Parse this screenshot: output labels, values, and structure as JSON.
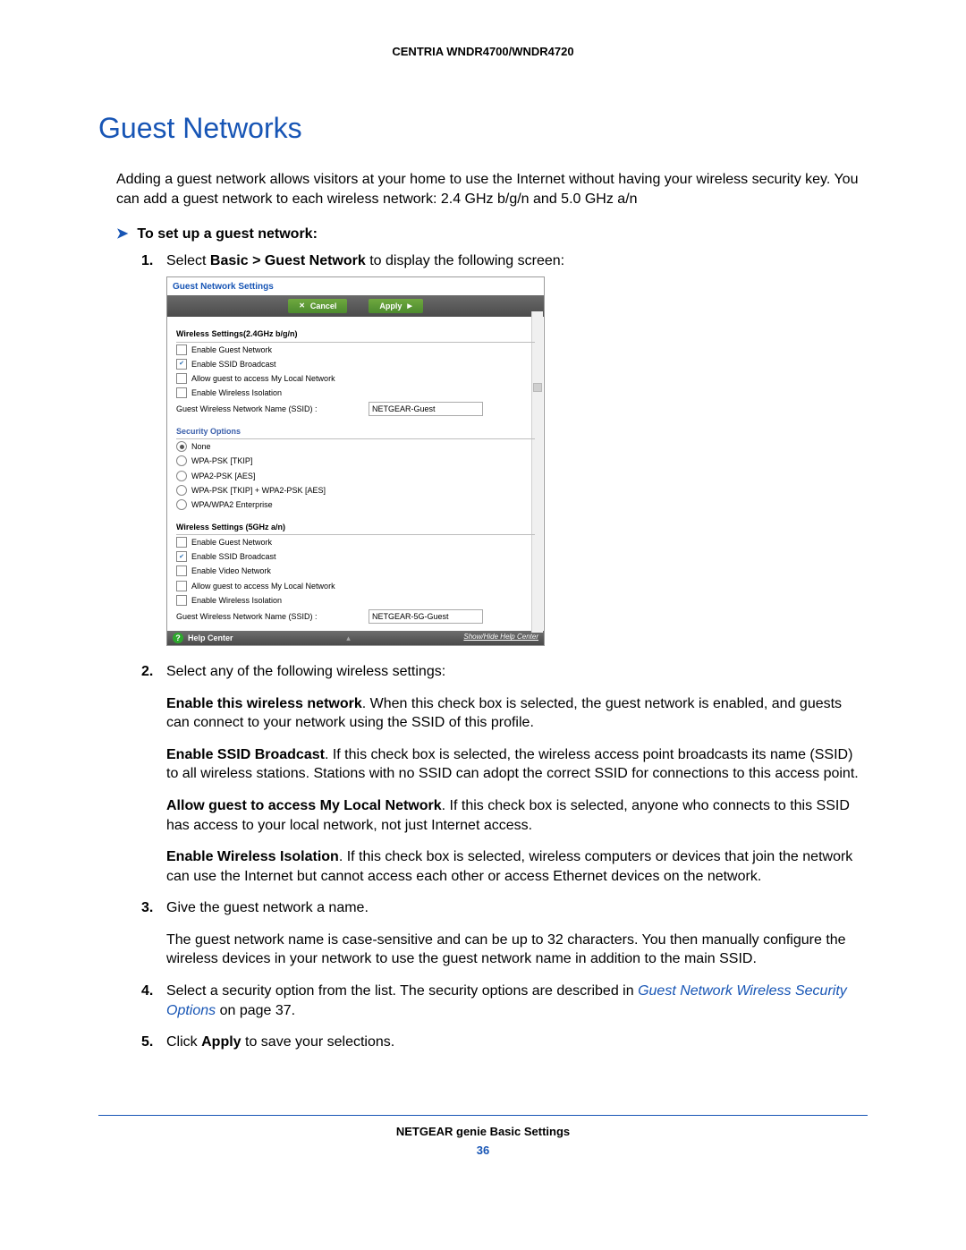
{
  "header": {
    "product": "CENTRIA WNDR4700/WNDR4720"
  },
  "section": {
    "title": "Guest Networks",
    "intro": "Adding a guest network allows visitors at your home to use the Internet without having your wireless security key. You can add a guest network to each wireless network: 2.4 GHz b/g/n and 5.0 GHz a/n",
    "task_heading": "To set up a guest network:"
  },
  "steps": {
    "s1": {
      "prefix": "Select ",
      "bold": "Basic > Guest Network",
      "suffix": " to display the following screen:"
    },
    "s2_intro": "Select any of the following wireless settings:",
    "s2a_b": "Enable this wireless network",
    "s2a_t": ". When this check box is selected, the guest network is enabled, and guests can connect to your network using the SSID of this profile.",
    "s2b_b": "Enable SSID Broadcast",
    "s2b_t": ". If this check box is selected, the wireless access point broadcasts its name (SSID) to all wireless stations. Stations with no SSID can adopt the correct SSID for connections to this access point.",
    "s2c_b": "Allow guest to access My Local Network",
    "s2c_t": ". If this check box is selected, anyone who connects to this SSID has access to your local network, not just Internet access.",
    "s2d_b": "Enable Wireless Isolation",
    "s2d_t": ". If this check box is selected, wireless computers or devices that join the network can use the Internet but cannot access each other or access Ethernet devices on the network.",
    "s3a": "Give the guest network a name.",
    "s3b": "The guest network name is case-sensitive and can be up to 32 characters. You then manually configure the wireless devices in your network to use the guest network name in addition to the main SSID.",
    "s4_prefix": "Select a security option from the list. The security options are described in ",
    "s4_link": "Guest Network Wireless Security Options",
    "s4_suffix": " on page 37.",
    "s5_prefix": "Click ",
    "s5_bold": "Apply",
    "s5_suffix": " to save your selections."
  },
  "ui": {
    "title": "Guest Network Settings",
    "cancel": "Cancel",
    "apply": "Apply",
    "sec24": "Wireless Settings(2.4GHz b/g/n)",
    "c_enable_guest": "Enable Guest Network",
    "c_enable_ssid": "Enable SSID Broadcast",
    "c_allow_local": "Allow guest to access My Local Network",
    "c_wireless_iso": "Enable Wireless Isolation",
    "ssid_label": "Guest Wireless Network Name (SSID) :",
    "ssid24_value": "NETGEAR-Guest",
    "sec_opts": "Security Options",
    "r_none": "None",
    "r_wpa_tkip": "WPA-PSK [TKIP]",
    "r_wpa2_aes": "WPA2-PSK [AES]",
    "r_mixed": "WPA-PSK [TKIP] + WPA2-PSK [AES]",
    "r_enterprise": "WPA/WPA2 Enterprise",
    "sec5": "Wireless Settings (5GHz a/n)",
    "c_enable_video": "Enable Video Network",
    "ssid5_value": "NETGEAR-5G-Guest",
    "help_center": "Help Center",
    "help_toggle": "Show/Hide Help Center"
  },
  "footer": {
    "text": "NETGEAR genie Basic Settings",
    "page": "36"
  }
}
